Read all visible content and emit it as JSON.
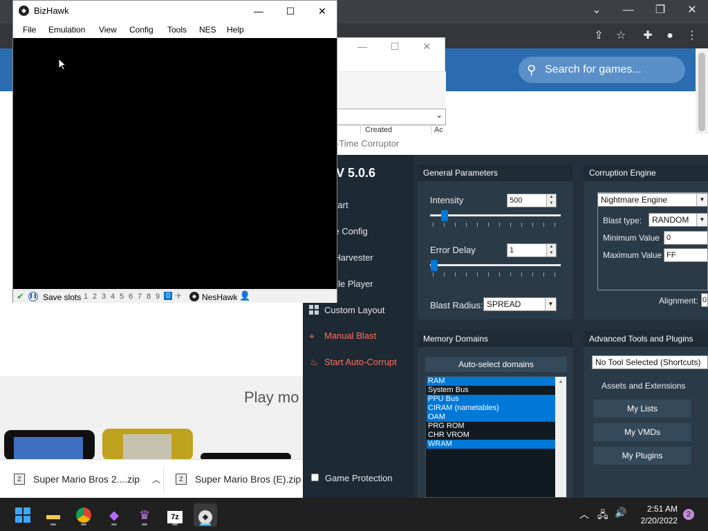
{
  "bizhawk": {
    "title": "BizHawk",
    "logo": "bizhawk-logo-icon",
    "menu": [
      "File",
      "Emulation",
      "View",
      "Config",
      "Tools",
      "NES",
      "Help"
    ],
    "status": {
      "save_slots_label": "Save slots",
      "slots": [
        "1",
        "2",
        "3",
        "4",
        "5",
        "6",
        "7",
        "8",
        "9",
        "0"
      ],
      "active_slot": "0",
      "core": "NesHawk"
    }
  },
  "browser": {
    "search_placeholder": "Search for games...",
    "play_more": "Play mo",
    "downloads": [
      {
        "name": "Super Mario Bros 2....zip"
      },
      {
        "name": "Super Mario Bros (E).zip"
      }
    ]
  },
  "mid_window": {
    "column_header": "Created",
    "column_header2": "Ac"
  },
  "rtc": {
    "title": "-Time Corruptor",
    "version": "V 5.0.6",
    "side_items": [
      {
        "label": "y Start"
      },
      {
        "label": "gine Config"
      },
      {
        "label": "ch Harvester"
      },
      {
        "label": "ckpile Player"
      },
      {
        "label": "Custom Layout"
      },
      {
        "label": "Manual Blast"
      },
      {
        "label": "Start Auto-Corrupt"
      }
    ],
    "game_protection": "Game Protection",
    "general": {
      "title": "General Parameters",
      "intensity_label": "Intensity",
      "intensity_value": "500",
      "error_delay_label": "Error Delay",
      "error_delay_value": "1",
      "blast_radius_label": "Blast Radius:",
      "blast_radius_value": "SPREAD"
    },
    "engine": {
      "title": "Corruption Engine",
      "engine_value": "Nightmare Engine",
      "blast_type_label": "Blast type:",
      "blast_type_value": "RANDOM",
      "min_label": "Minimum Value",
      "min_value": "0",
      "max_label": "Maximum Value",
      "max_value": "FF",
      "alignment_label": "Alignment:",
      "alignment_value": "0"
    },
    "memory": {
      "title": "Memory Domains",
      "auto_select": "Auto-select domains",
      "domains": [
        {
          "name": "RAM",
          "selected": true
        },
        {
          "name": "System Bus",
          "selected": false
        },
        {
          "name": "PPU Bus",
          "selected": true
        },
        {
          "name": "CIRAM (nametables)",
          "selected": true
        },
        {
          "name": "OAM",
          "selected": true
        },
        {
          "name": "PRG ROM",
          "selected": false
        },
        {
          "name": "CHR VROM",
          "selected": false
        },
        {
          "name": "WRAM",
          "selected": true
        }
      ]
    },
    "advanced": {
      "title": "Advanced Tools and Plugins",
      "tool_select": "No Tool Selected (Shortcuts)",
      "assets_label": "Assets and Extensions",
      "my_lists": "My Lists",
      "my_vmds": "My VMDs",
      "my_plugins": "My Plugins"
    }
  },
  "taskbar": {
    "time": "2:51 AM",
    "date": "2/20/2022",
    "notifications": "2"
  }
}
